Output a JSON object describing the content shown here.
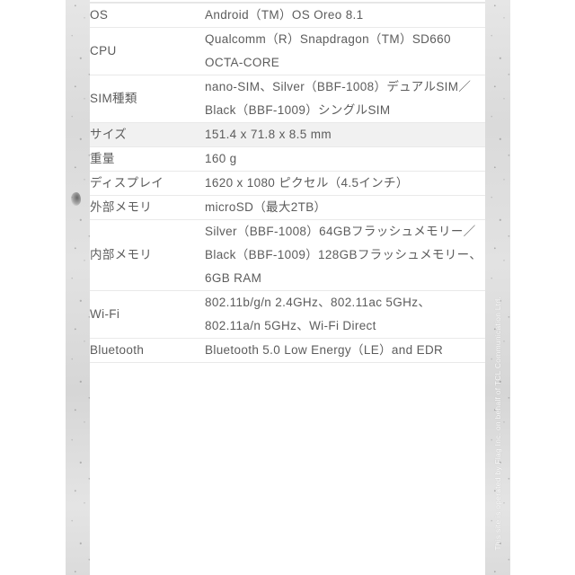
{
  "page": {
    "background_color": "#ffffff",
    "text_color": "#5c5c5c",
    "stripe_color": "#f1f1f1",
    "border_color": "#e9e9e9"
  },
  "side_strip": {
    "credit_text": "This site is operated by Flag Inc. on behalf of TCL Communication Ltd.",
    "texture_color": "#dcdcdc"
  },
  "spec_table": {
    "rows": [
      {
        "label": "OS",
        "value": "Android（TM）OS Oreo 8.1",
        "striped": false
      },
      {
        "label": "CPU",
        "value": "Qualcomm（R）Snapdragon（TM）SD660 OCTA-CORE",
        "striped": false
      },
      {
        "label": "SIM種類",
        "value": "nano-SIM、Silver（BBF-1008）デュアルSIM／Black（BBF-1009）シングルSIM",
        "striped": false
      },
      {
        "label": "サイズ",
        "value": "151.4 x 71.8 x 8.5 mm",
        "striped": true
      },
      {
        "label": "重量",
        "value": "160 g",
        "striped": false
      },
      {
        "label": "ディスプレイ",
        "value": "1620 x 1080 ピクセル（4.5インチ）",
        "striped": false
      },
      {
        "label": "外部メモリ",
        "value": "microSD（最大2TB）",
        "striped": false
      },
      {
        "label": "内部メモリ",
        "value": "Silver（BBF-1008）64GBフラッシュメモリー／Black（BBF-1009）128GBフラッシュメモリー、6GB RAM",
        "striped": false
      },
      {
        "label": "Wi-Fi",
        "value": "802.11b/g/n 2.4GHz、802.11ac 5GHz、802.11a/n 5GHz、Wi-Fi Direct",
        "striped": false
      },
      {
        "label": "Bluetooth",
        "value": "Bluetooth 5.0 Low Energy（LE）and EDR",
        "striped": false
      }
    ]
  }
}
